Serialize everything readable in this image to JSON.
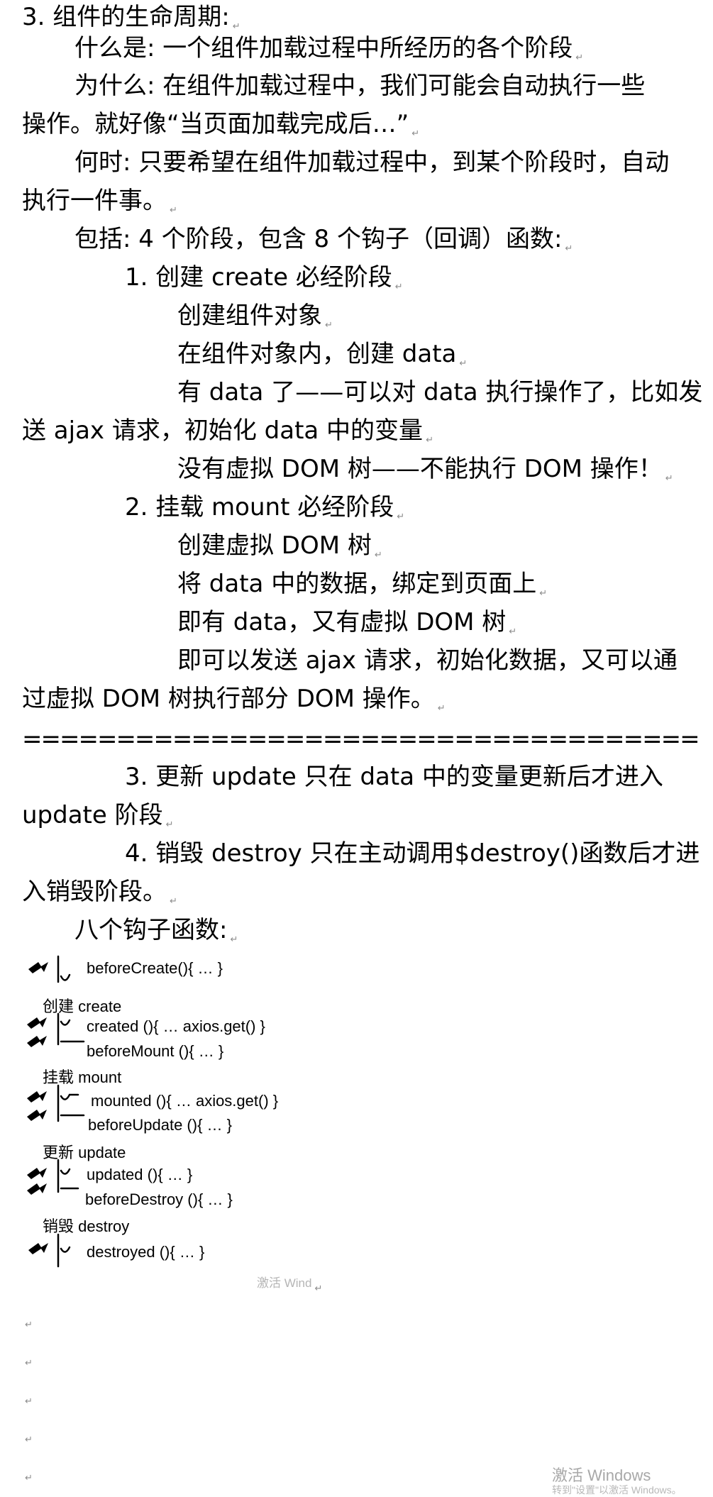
{
  "document": {
    "lines": [
      {
        "text": "3.  组件的生命周期:",
        "indent": 0
      },
      {
        "text": "什么是: 一个组件加载过程中所经历的各个阶段",
        "indent": 2
      },
      {
        "text": "为什么: 在组件加载过程中，我们可能会自动执行一些",
        "indent": 2
      },
      {
        "text": "操作。就好像“当页面加载完成后…”",
        "indent": 0
      },
      {
        "text": "何时: 只要希望在组件加载过程中，到某个阶段时，自动",
        "indent": 2
      },
      {
        "text": "执行一件事。",
        "indent": 0
      },
      {
        "text": "包括: 4 个阶段，包含 8 个钩子（回调）函数:",
        "indent": 2
      },
      {
        "text": "1.  创建 create  必经阶段",
        "indent": 4
      },
      {
        "text": "创建组件对象",
        "indent": 6
      },
      {
        "text": "在组件对象内，创建 data",
        "indent": 6
      },
      {
        "text": "有 data 了——可以对 data 执行操作了，比如发",
        "indent": 6
      },
      {
        "text": "送 ajax 请求，初始化 data 中的变量",
        "indent": 0
      },
      {
        "text": "没有虚拟 DOM 树——不能执行 DOM 操作！",
        "indent": 6
      },
      {
        "text": "2.  挂载 mount 必经阶段",
        "indent": 4
      },
      {
        "text": "创建虚拟 DOM 树",
        "indent": 6
      },
      {
        "text": "将 data 中的数据，绑定到页面上",
        "indent": 6
      },
      {
        "text": "即有 data，又有虚拟 DOM 树",
        "indent": 6
      },
      {
        "text": "即可以发送 ajax 请求，初始化数据，又可以通",
        "indent": 6
      },
      {
        "text": "过虚拟 DOM 树执行部分 DOM 操作。",
        "indent": 0
      }
    ],
    "separator": "=====================================================",
    "lines2": [
      {
        "text": "3.  更新  update  只在  data  中的变量更新后才进入",
        "indent": 4
      },
      {
        "text": "update 阶段",
        "indent": 0
      },
      {
        "text": "4.  销毁 destroy  只在主动调用$destroy()函数后才进",
        "indent": 4
      },
      {
        "text": "入销毁阶段。",
        "indent": 0
      },
      {
        "text": "八个钩子函数:",
        "indent": 2
      }
    ]
  },
  "figure": {
    "hooks": [
      "beforeCreate(){ … }",
      "created (){ …  axios.get()    }",
      "beforeMount (){ … }",
      "mounted (){ …  axios.get()   }",
      "beforeUpdate (){ … }",
      "updated (){ … }",
      "beforeDestroy (){ … }",
      "destroyed (){ … }"
    ],
    "phases": [
      "创建  create",
      "挂载  mount",
      "更新  update",
      "销毁  destroy"
    ]
  },
  "watermarks": {
    "inline": "激活 Wind",
    "activate_title": "激活 Windows",
    "activate_sub": "转到\"设置\"以激活 Windows。"
  }
}
